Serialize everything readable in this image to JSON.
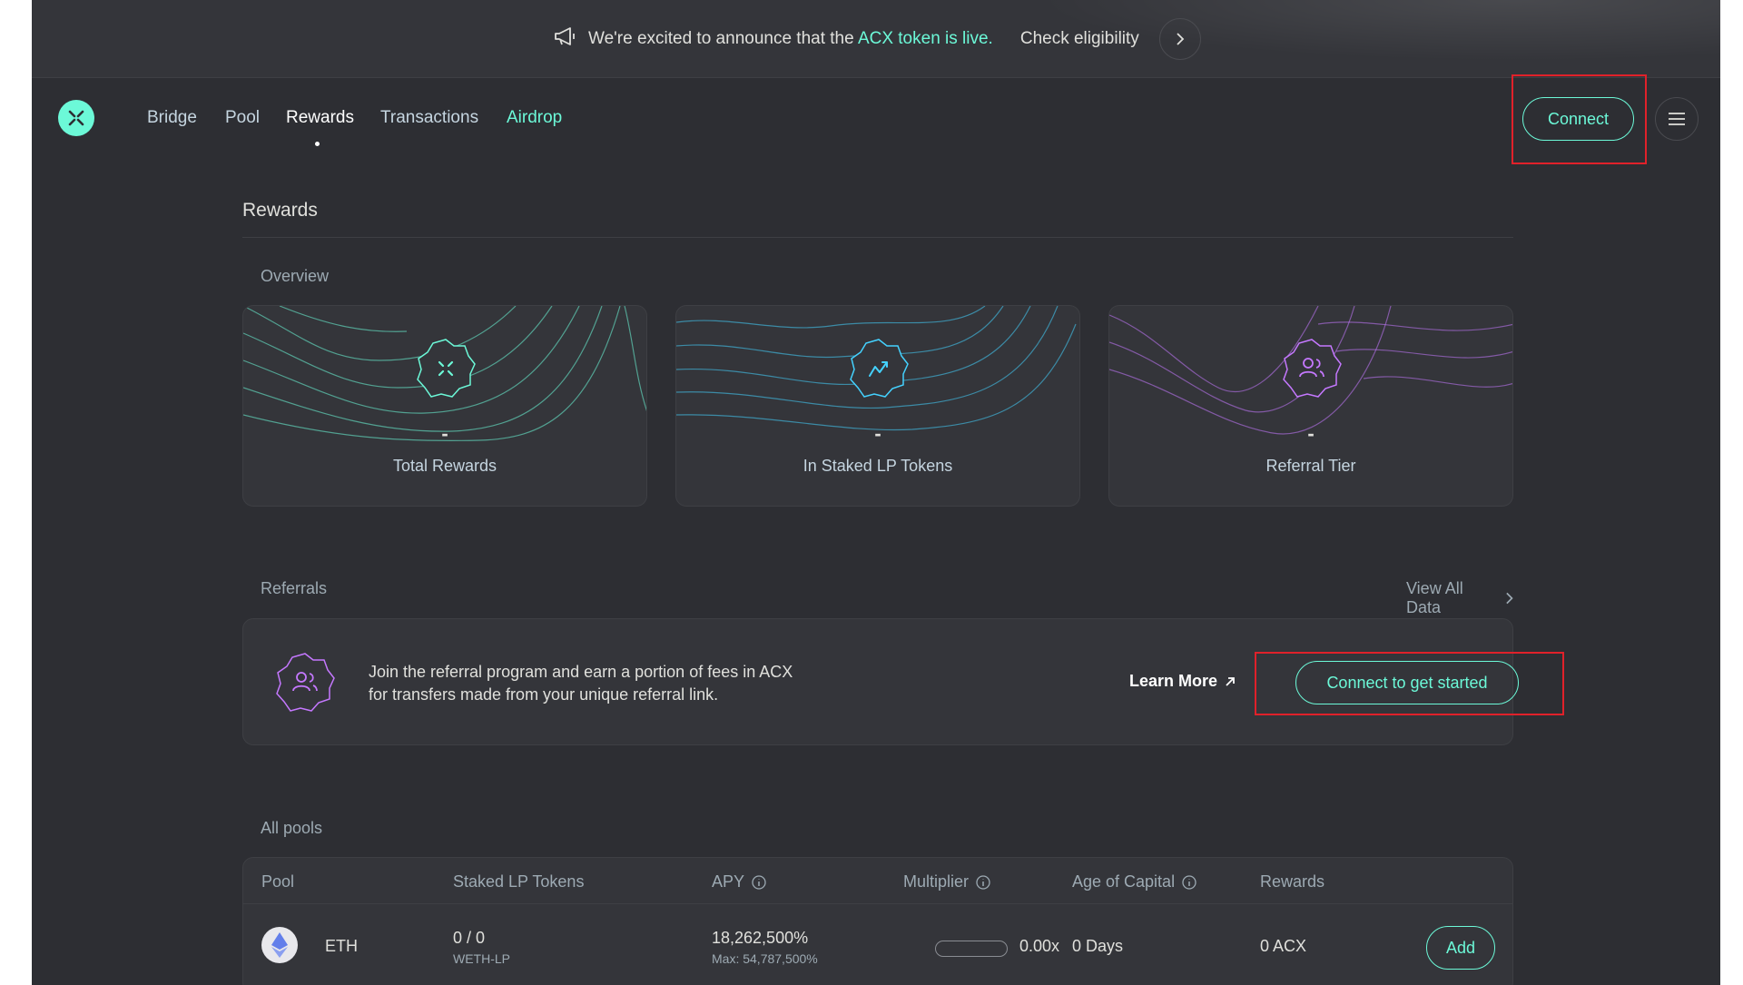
{
  "banner": {
    "text_before": "We're excited to announce that the",
    "link_text": "ACX token is live.",
    "check_label": "Check eligibility",
    "megaphone_icon": "megaphone-icon",
    "arrow_icon": "chevron-right-icon"
  },
  "nav": {
    "logo_icon": "across-logo-icon",
    "links": [
      {
        "label": "Bridge",
        "active": false
      },
      {
        "label": "Pool",
        "active": false
      },
      {
        "label": "Rewards",
        "active": true
      },
      {
        "label": "Transactions",
        "active": false
      },
      {
        "label": "Airdrop",
        "active": false
      }
    ],
    "connect_label": "Connect",
    "menu_icon": "hamburger-menu-icon"
  },
  "page": {
    "title": "Rewards",
    "overview_label": "Overview",
    "cards": [
      {
        "value": "-",
        "label": "Total Rewards",
        "icon": "across-logo-icon",
        "color": "#6cf9d8"
      },
      {
        "value": "-",
        "label": "In Staked LP Tokens",
        "icon": "trend-up-icon",
        "color": "#44d2ff"
      },
      {
        "value": "-",
        "label": "Referral Tier",
        "icon": "users-icon",
        "color": "#c578ff"
      }
    ]
  },
  "referrals": {
    "label": "Referrals",
    "view_all": "View All Data",
    "line1": "Join the referral program and earn a portion of fees in ACX",
    "line2": "for transfers made from your unique referral link.",
    "learn_more": "Learn More",
    "connect_label": "Connect to get started"
  },
  "pools": {
    "label": "All pools",
    "headers": [
      "Pool",
      "Staked LP Tokens",
      "APY",
      "Multiplier",
      "Age of Capital",
      "Rewards"
    ],
    "rows": [
      {
        "pool": "ETH",
        "staked": "0 / 0",
        "staked_sub": "WETH-LP",
        "apy": "18,262,500%",
        "apy_max": "Max: 54,787,500%",
        "multiplier_fill": 0,
        "multiplier": "0.00x",
        "age": "0 Days",
        "rewards": "0 ACX",
        "action": "Add"
      }
    ]
  },
  "colors": {
    "accent": "#6cf9d8",
    "background": "#2d2e33",
    "highlight_box": "#e0212a"
  }
}
